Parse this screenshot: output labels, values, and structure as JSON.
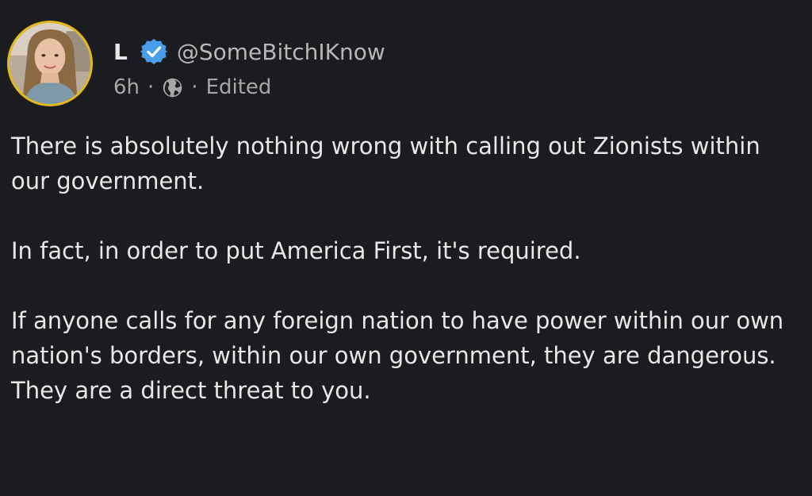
{
  "post": {
    "author": {
      "display_name": "L",
      "handle": "@SomeBitchIKnow",
      "verified": true,
      "avatar_border_color": "#e2b91c",
      "verified_color": "#4a9de8"
    },
    "meta": {
      "time": "6h",
      "separator": "·",
      "visibility_icon": "globe-icon",
      "edited_label": "Edited"
    },
    "paragraphs": [
      "There is absolutely nothing wrong with calling out Zionists within our government.",
      "In fact, in order to put America First, it's required.",
      "If anyone calls for any foreign nation to have power within our own nation's borders, within our own government, they are dangerous. They are a direct threat to you."
    ]
  },
  "colors": {
    "background": "#1b1c1f",
    "text": "#e8e8e8",
    "secondary_text": "#a6a6a6"
  }
}
